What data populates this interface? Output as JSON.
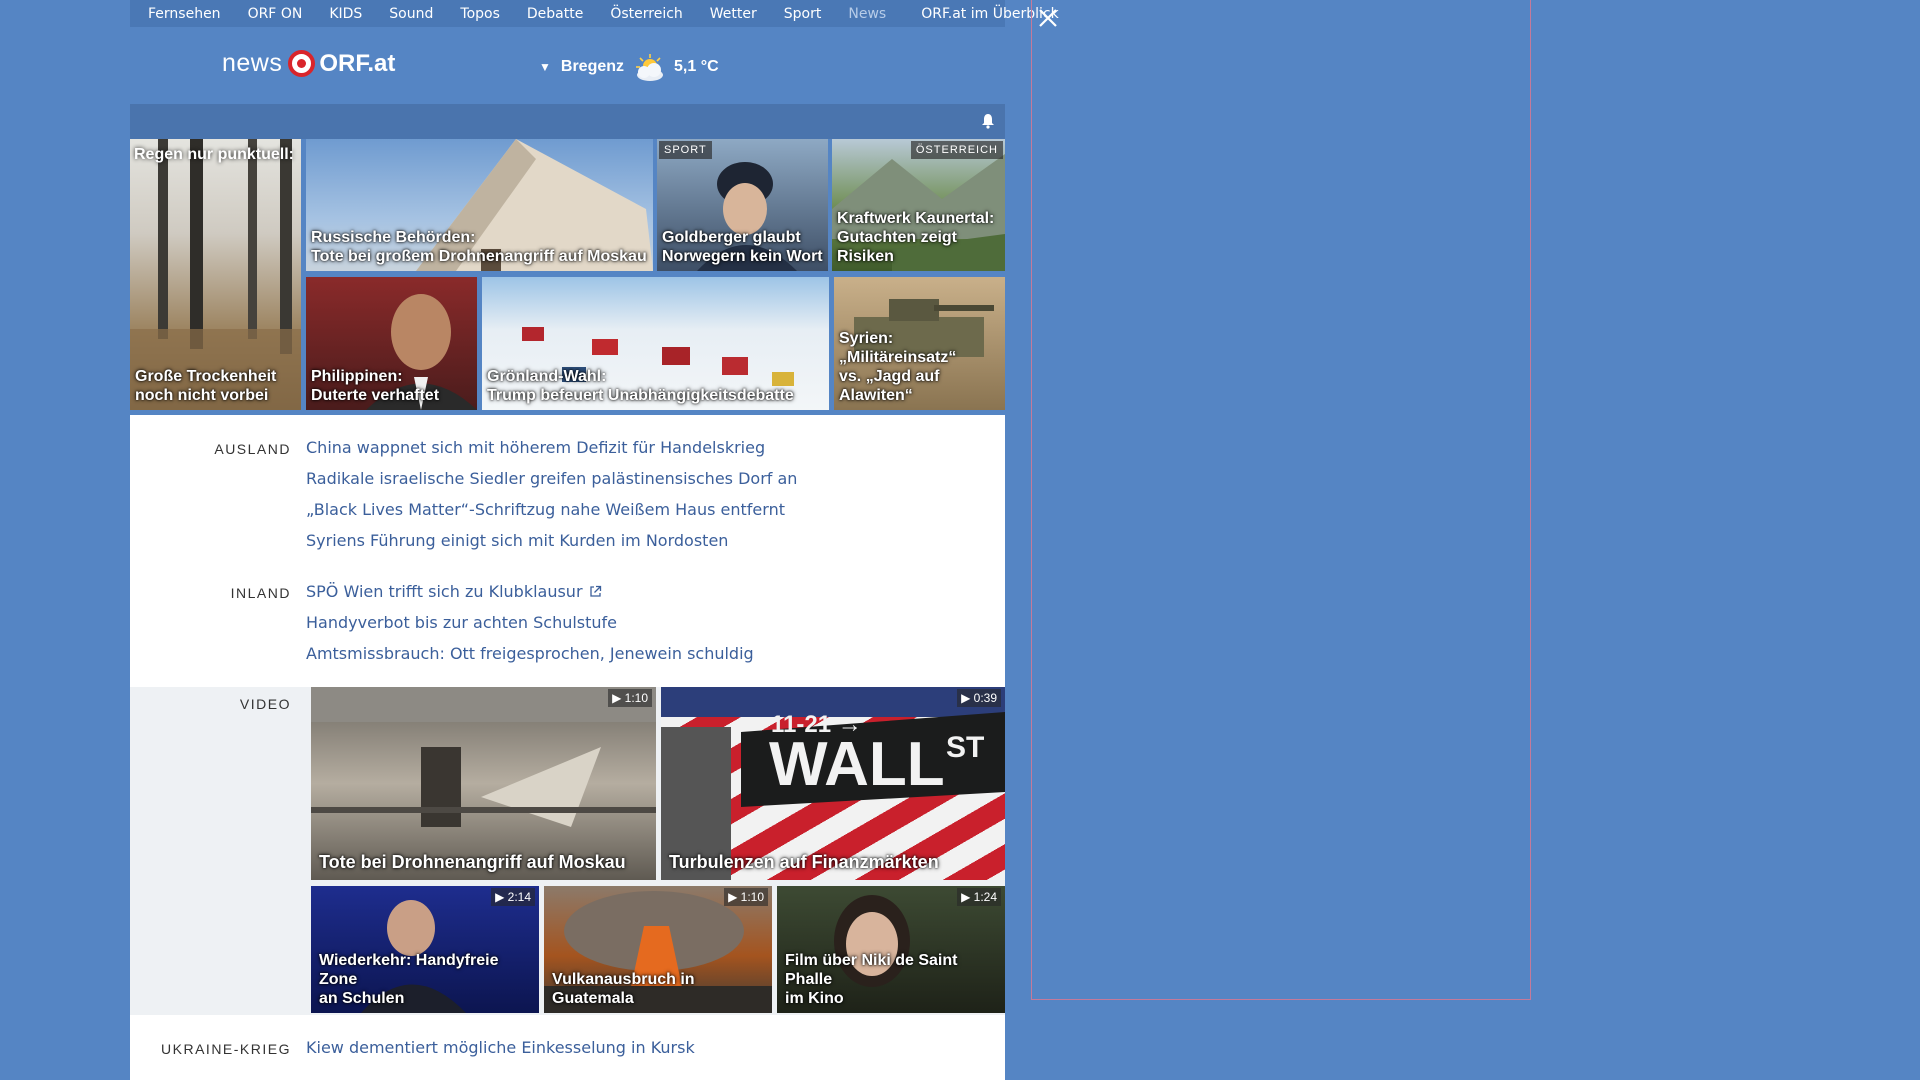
{
  "nav": {
    "items": [
      "Fernsehen",
      "ORF ON",
      "KIDS",
      "Sound",
      "Topos",
      "Debatte",
      "Österreich",
      "Wetter",
      "Sport",
      "News"
    ],
    "active": "News",
    "overview": "ORF.at im Überblick"
  },
  "header": {
    "logo_news": "news",
    "logo_orf": "ORF.at",
    "weather": {
      "location": "Bregenz",
      "temperature": "5,1 °C",
      "icon": "partly-cloudy-icon"
    }
  },
  "tiles": {
    "t1": {
      "topcaption": "Regen nur punktuell:",
      "caption_line1": "Große Trockenheit",
      "caption_line2": "noch nicht vorbei"
    },
    "t2": {
      "caption_line1": "Russische Behörden:",
      "caption_line2": "Tote bei großem Drohnenangriff auf Moskau"
    },
    "t3": {
      "badge": "SPORT",
      "caption_line1": "Goldberger glaubt",
      "caption_line2": "Norwegern kein Wort"
    },
    "t4": {
      "badge": "ÖSTERREICH",
      "caption_line1": "Kraftwerk Kaunertal:",
      "caption_line2": "Gutachten zeigt Risiken"
    },
    "t5": {
      "caption_line1": "Philippinen:",
      "caption_line2": "Duterte verhaftet"
    },
    "t6": {
      "caption_line1": "Grönland-Wahl:",
      "caption_line2": "Trump befeuert Unabhängigkeitsdebatte"
    },
    "t7": {
      "caption_line1": "Syrien: „Militäreinsatz“",
      "caption_line2": "vs. „Jagd auf Alawiten“"
    }
  },
  "sections": {
    "ausland": {
      "label": "AUSLAND",
      "links": [
        "China wappnet sich mit höherem Defizit für Handelskrieg",
        "Radikale israelische Siedler greifen palästinensisches Dorf an",
        "„Black Lives Matter“-Schriftzug nahe Weißem Haus entfernt",
        "Syriens Führung einigt sich mit Kurden im Nordosten"
      ]
    },
    "inland": {
      "label": "INLAND",
      "links": [
        "SPÖ Wien trifft sich zu Klubklausur",
        "Handyverbot bis zur achten Schulstufe",
        "Amtsmissbrauch: Ott freigesprochen, Jenewein schuldig"
      ]
    },
    "video": {
      "label": "VIDEO",
      "items": [
        {
          "title": "Tote bei Drohnenangriff auf Moskau",
          "duration": "▶ 1:10"
        },
        {
          "title": "Turbulenzen auf Finanzmärkten",
          "duration": "▶ 0:39"
        },
        {
          "title_line1": "Wiederkehr: Handyfreie Zone",
          "title_line2": "an Schulen",
          "duration": "▶ 2:14"
        },
        {
          "title": "Vulkanausbruch in Guatemala",
          "duration": "▶ 1:10"
        },
        {
          "title_line1": "Film über Niki de Saint Phalle",
          "title_line2": "im Kino",
          "duration": "▶ 1:24"
        }
      ]
    },
    "ukraine": {
      "label": "UKRAINE-KRIEG",
      "links": [
        "Kiew dementiert mögliche Einkesselung in Kursk"
      ]
    }
  },
  "video_sign_text": {
    "street_number": "11-21 →",
    "street": "WALL",
    "suffix": "ST"
  }
}
